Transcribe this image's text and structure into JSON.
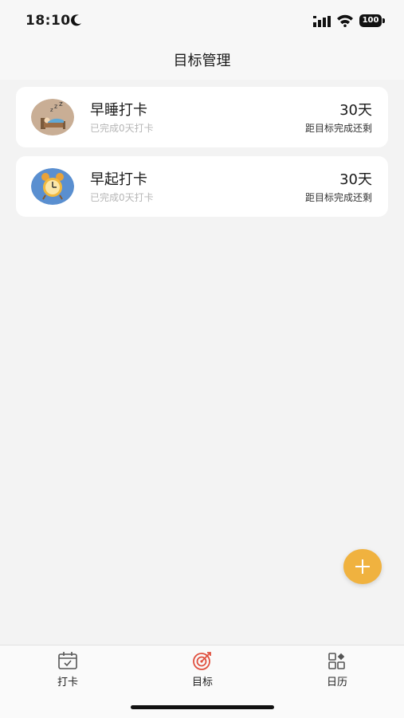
{
  "status_bar": {
    "time": "18:10",
    "battery": "100"
  },
  "header": {
    "title": "目标管理"
  },
  "goals": [
    {
      "title": "早睡打卡",
      "progress": "已完成0天打卡",
      "days": "30天",
      "remaining_label": "距目标完成还剩",
      "icon": "sleep-bed-icon"
    },
    {
      "title": "早起打卡",
      "progress": "已完成0天打卡",
      "days": "30天",
      "remaining_label": "距目标完成还剩",
      "icon": "alarm-clock-icon"
    }
  ],
  "fab": {
    "icon": "plus-icon"
  },
  "tabs": [
    {
      "label": "打卡",
      "icon": "calendar-check-icon",
      "active": false
    },
    {
      "label": "目标",
      "icon": "target-icon",
      "active": true
    },
    {
      "label": "日历",
      "icon": "grid-apps-icon",
      "active": false
    }
  ],
  "colors": {
    "accent": "#f0b23f",
    "active_tab": "#e0503f",
    "background": "#f3f3f3"
  }
}
